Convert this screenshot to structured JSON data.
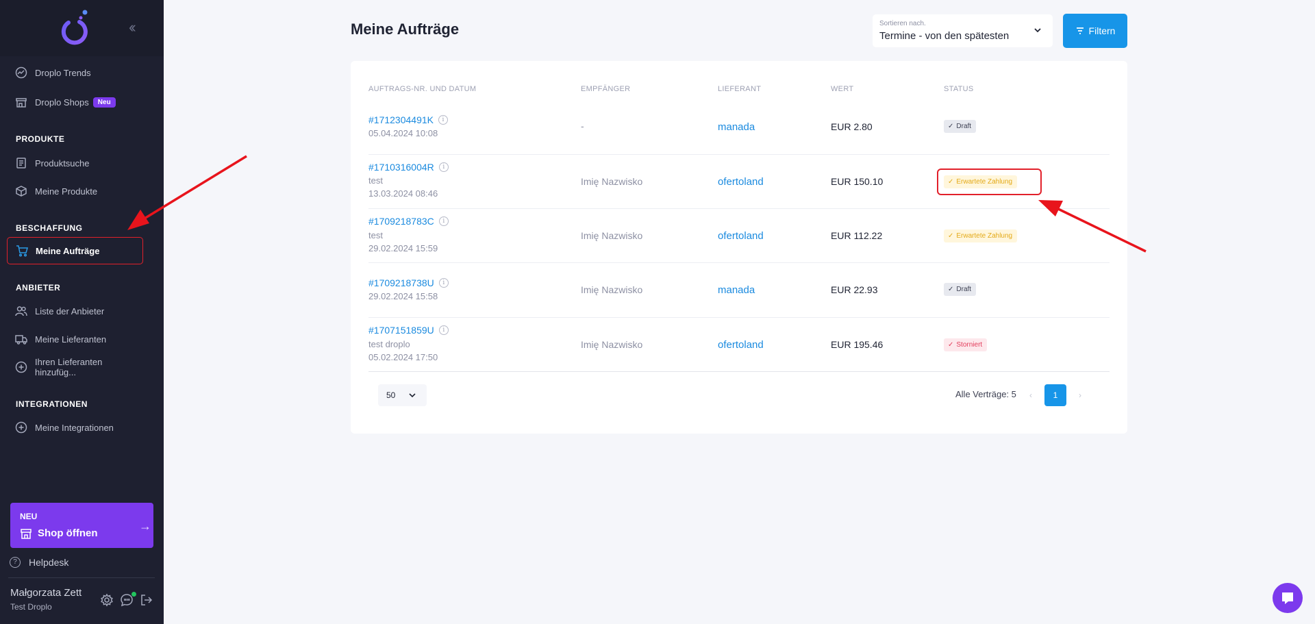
{
  "sidebar": {
    "items": [
      {
        "label": "Droplo Trends"
      },
      {
        "label": "Droplo Shops",
        "badge": "Neu"
      },
      {
        "label": "Produktsuche"
      },
      {
        "label": "Meine Produkte"
      },
      {
        "label": "Meine Aufträge"
      },
      {
        "label": "Liste der Anbieter"
      },
      {
        "label": "Meine Lieferanten"
      },
      {
        "label": "Ihren Lieferanten hinzufüg..."
      },
      {
        "label": "Meine Integrationen"
      }
    ],
    "sections": {
      "produkte": "PRODUKTE",
      "beschaffung": "BESCHAFFUNG",
      "anbieter": "ANBIETER",
      "integrationen": "INTEGRATIONEN"
    },
    "promo": {
      "label": "NEU",
      "title": "Shop öffnen"
    },
    "helpdesk": "Helpdesk",
    "user": {
      "name": "Małgorzata Zett",
      "shop": "Test Droplo"
    },
    "colors": {
      "accent": "#7c3aed",
      "background": "#1e2030"
    }
  },
  "header": {
    "title": "Meine Aufträge",
    "sort_label": "Sortieren nach.",
    "sort_value": "Termine - von den spätesten",
    "filter_label": "Filtern"
  },
  "table": {
    "columns": [
      "AUFTRAGS-NR. UND DATUM",
      "EMPFÄNGER",
      "LIEFERANT",
      "WERT",
      "STATUS"
    ],
    "rows": [
      {
        "id": "#1712304491K",
        "sub1": "05.04.2024 10:08",
        "sub2": "",
        "recipient": "-",
        "supplier": "manada",
        "value": "EUR 2.80",
        "status": "Draft"
      },
      {
        "id": "#1710316004R",
        "sub1": "test",
        "sub2": "13.03.2024 08:46",
        "recipient": "Imię Nazwisko",
        "supplier": "ofertoland",
        "value": "EUR 150.10",
        "status": "Erwartete Zahlung"
      },
      {
        "id": "#1709218783C",
        "sub1": "test",
        "sub2": "29.02.2024 15:59",
        "recipient": "Imię Nazwisko",
        "supplier": "ofertoland",
        "value": "EUR 112.22",
        "status": "Erwartete Zahlung"
      },
      {
        "id": "#1709218738U",
        "sub1": "29.02.2024 15:58",
        "sub2": "",
        "recipient": "Imię Nazwisko",
        "supplier": "manada",
        "value": "EUR 22.93",
        "status": "Draft"
      },
      {
        "id": "#1707151859U",
        "sub1": "test droplo",
        "sub2": "05.02.2024 17:50",
        "recipient": "Imię Nazwisko",
        "supplier": "ofertoland",
        "value": "EUR 195.46",
        "status": "Storniert"
      }
    ],
    "status_colors": {
      "draft": "#3d4052",
      "waiting": "#e3a916",
      "cancelled": "#e23b5a"
    }
  },
  "footer": {
    "per_page": "50",
    "total": "Alle Verträge: 5",
    "page": "1",
    "prev": "‹",
    "next": "›"
  },
  "icons": {
    "info": "i",
    "check": "✓",
    "arrow": "→"
  }
}
